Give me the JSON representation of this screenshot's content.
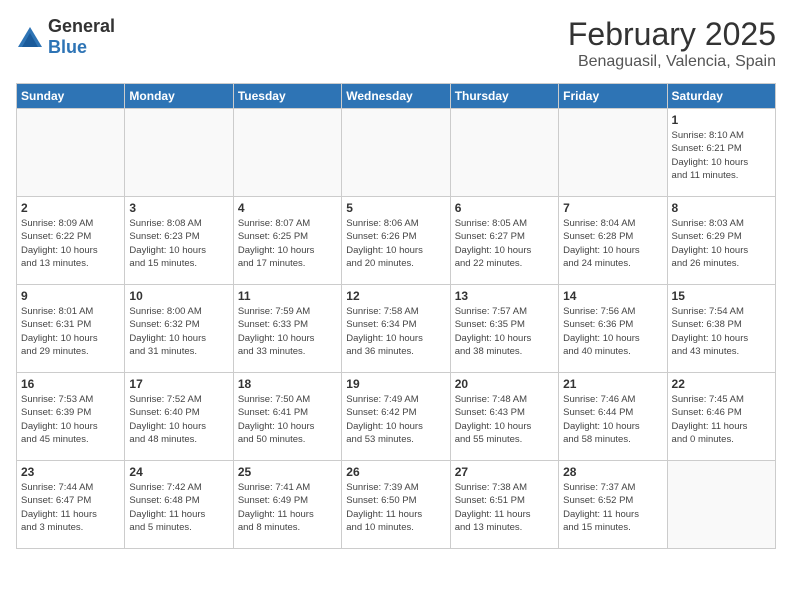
{
  "header": {
    "logo": {
      "general": "General",
      "blue": "Blue"
    },
    "month": "February 2025",
    "location": "Benaguasil, Valencia, Spain"
  },
  "weekdays": [
    "Sunday",
    "Monday",
    "Tuesday",
    "Wednesday",
    "Thursday",
    "Friday",
    "Saturday"
  ],
  "weeks": [
    [
      {
        "day": "",
        "info": ""
      },
      {
        "day": "",
        "info": ""
      },
      {
        "day": "",
        "info": ""
      },
      {
        "day": "",
        "info": ""
      },
      {
        "day": "",
        "info": ""
      },
      {
        "day": "",
        "info": ""
      },
      {
        "day": "1",
        "info": "Sunrise: 8:10 AM\nSunset: 6:21 PM\nDaylight: 10 hours\nand 11 minutes."
      }
    ],
    [
      {
        "day": "2",
        "info": "Sunrise: 8:09 AM\nSunset: 6:22 PM\nDaylight: 10 hours\nand 13 minutes."
      },
      {
        "day": "3",
        "info": "Sunrise: 8:08 AM\nSunset: 6:23 PM\nDaylight: 10 hours\nand 15 minutes."
      },
      {
        "day": "4",
        "info": "Sunrise: 8:07 AM\nSunset: 6:25 PM\nDaylight: 10 hours\nand 17 minutes."
      },
      {
        "day": "5",
        "info": "Sunrise: 8:06 AM\nSunset: 6:26 PM\nDaylight: 10 hours\nand 20 minutes."
      },
      {
        "day": "6",
        "info": "Sunrise: 8:05 AM\nSunset: 6:27 PM\nDaylight: 10 hours\nand 22 minutes."
      },
      {
        "day": "7",
        "info": "Sunrise: 8:04 AM\nSunset: 6:28 PM\nDaylight: 10 hours\nand 24 minutes."
      },
      {
        "day": "8",
        "info": "Sunrise: 8:03 AM\nSunset: 6:29 PM\nDaylight: 10 hours\nand 26 minutes."
      }
    ],
    [
      {
        "day": "9",
        "info": "Sunrise: 8:01 AM\nSunset: 6:31 PM\nDaylight: 10 hours\nand 29 minutes."
      },
      {
        "day": "10",
        "info": "Sunrise: 8:00 AM\nSunset: 6:32 PM\nDaylight: 10 hours\nand 31 minutes."
      },
      {
        "day": "11",
        "info": "Sunrise: 7:59 AM\nSunset: 6:33 PM\nDaylight: 10 hours\nand 33 minutes."
      },
      {
        "day": "12",
        "info": "Sunrise: 7:58 AM\nSunset: 6:34 PM\nDaylight: 10 hours\nand 36 minutes."
      },
      {
        "day": "13",
        "info": "Sunrise: 7:57 AM\nSunset: 6:35 PM\nDaylight: 10 hours\nand 38 minutes."
      },
      {
        "day": "14",
        "info": "Sunrise: 7:56 AM\nSunset: 6:36 PM\nDaylight: 10 hours\nand 40 minutes."
      },
      {
        "day": "15",
        "info": "Sunrise: 7:54 AM\nSunset: 6:38 PM\nDaylight: 10 hours\nand 43 minutes."
      }
    ],
    [
      {
        "day": "16",
        "info": "Sunrise: 7:53 AM\nSunset: 6:39 PM\nDaylight: 10 hours\nand 45 minutes."
      },
      {
        "day": "17",
        "info": "Sunrise: 7:52 AM\nSunset: 6:40 PM\nDaylight: 10 hours\nand 48 minutes."
      },
      {
        "day": "18",
        "info": "Sunrise: 7:50 AM\nSunset: 6:41 PM\nDaylight: 10 hours\nand 50 minutes."
      },
      {
        "day": "19",
        "info": "Sunrise: 7:49 AM\nSunset: 6:42 PM\nDaylight: 10 hours\nand 53 minutes."
      },
      {
        "day": "20",
        "info": "Sunrise: 7:48 AM\nSunset: 6:43 PM\nDaylight: 10 hours\nand 55 minutes."
      },
      {
        "day": "21",
        "info": "Sunrise: 7:46 AM\nSunset: 6:44 PM\nDaylight: 10 hours\nand 58 minutes."
      },
      {
        "day": "22",
        "info": "Sunrise: 7:45 AM\nSunset: 6:46 PM\nDaylight: 11 hours\nand 0 minutes."
      }
    ],
    [
      {
        "day": "23",
        "info": "Sunrise: 7:44 AM\nSunset: 6:47 PM\nDaylight: 11 hours\nand 3 minutes."
      },
      {
        "day": "24",
        "info": "Sunrise: 7:42 AM\nSunset: 6:48 PM\nDaylight: 11 hours\nand 5 minutes."
      },
      {
        "day": "25",
        "info": "Sunrise: 7:41 AM\nSunset: 6:49 PM\nDaylight: 11 hours\nand 8 minutes."
      },
      {
        "day": "26",
        "info": "Sunrise: 7:39 AM\nSunset: 6:50 PM\nDaylight: 11 hours\nand 10 minutes."
      },
      {
        "day": "27",
        "info": "Sunrise: 7:38 AM\nSunset: 6:51 PM\nDaylight: 11 hours\nand 13 minutes."
      },
      {
        "day": "28",
        "info": "Sunrise: 7:37 AM\nSunset: 6:52 PM\nDaylight: 11 hours\nand 15 minutes."
      },
      {
        "day": "",
        "info": ""
      }
    ]
  ]
}
